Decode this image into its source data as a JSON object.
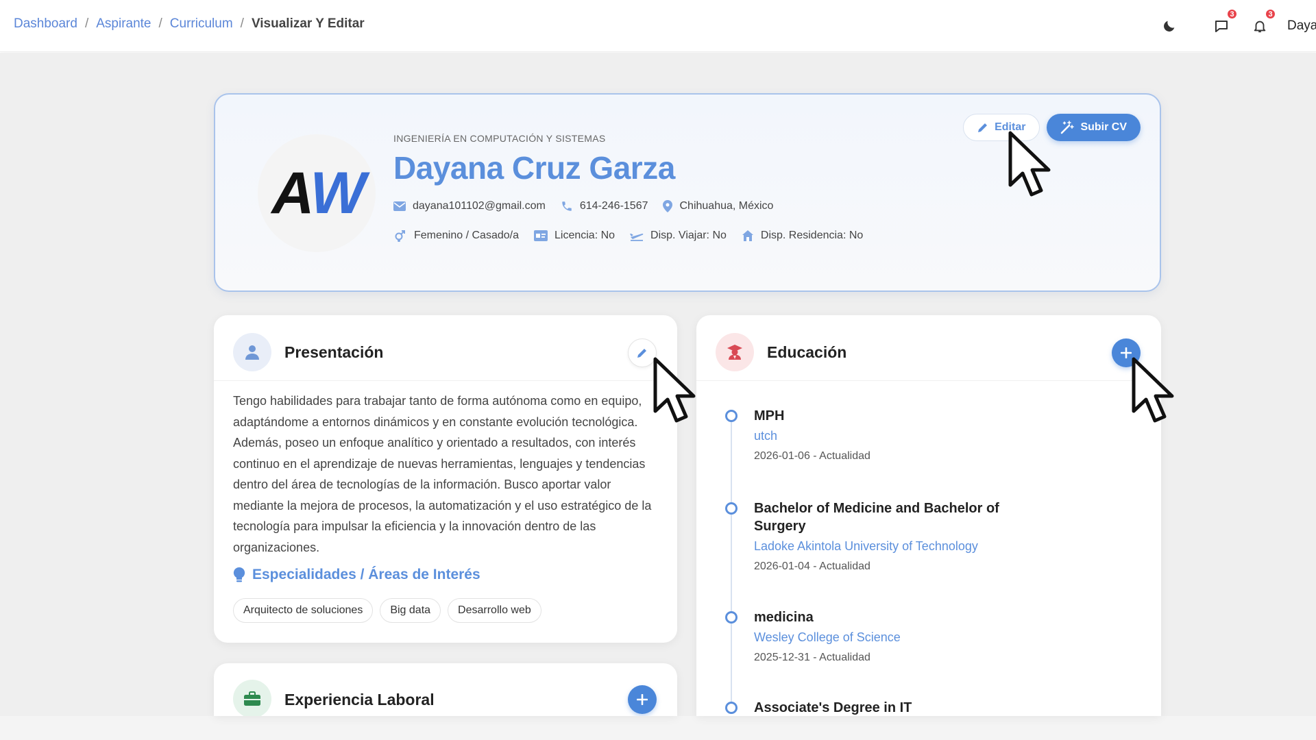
{
  "breadcrumb": {
    "items": [
      "Dashboard",
      "Aspirante",
      "Curriculum"
    ],
    "current": "Visualizar Y Editar",
    "separator": "/"
  },
  "topbar": {
    "theme_icon": "moon-icon",
    "messages_badge": "3",
    "notifications_badge": "3",
    "username": "Daya"
  },
  "profile": {
    "logo_text_a": "A",
    "logo_text_w": "W",
    "career": "INGENIERÍA EN COMPUTACIÓN Y SISTEMAS",
    "name": "Dayana Cruz Garza",
    "email": "dayana101102@gmail.com",
    "phone": "614-246-1567",
    "location": "Chihuahua, México",
    "gender_status": "Femenino / Casado/a",
    "license": "Licencia: No",
    "travel": "Disp. Viajar: No",
    "residence": "Disp. Residencia: No",
    "edit_label": "Editar",
    "upload_label": "Subir CV"
  },
  "presentation": {
    "title": "Presentación",
    "text": "Tengo habilidades para trabajar tanto de forma autónoma como en equipo, adaptándome a entornos dinámicos y en constante evolución tecnológica. Además, poseo un enfoque analítico y orientado a resultados, con interés continuo en el aprendizaje de nuevas herramientas, lenguajes y tendencias dentro del área de tecnologías de la información. Busco aportar valor mediante la mejora de procesos, la automatización y el uso estratégico de la tecnología para impulsar la eficiencia y la innovación dentro de las organizaciones.",
    "interests_title": "Especialidades / Áreas de Interés",
    "tags": [
      "Arquitecto de soluciones",
      "Big data",
      "Desarrollo web"
    ]
  },
  "experience": {
    "title": "Experiencia Laboral"
  },
  "education": {
    "title": "Educación",
    "items": [
      {
        "degree": "MPH",
        "school": "utch",
        "dates": "2026-01-06 - Actualidad"
      },
      {
        "degree": "Bachelor of Medicine and Bachelor of Surgery",
        "school": "Ladoke Akintola University of Technology",
        "dates": "2026-01-04 - Actualidad"
      },
      {
        "degree": "medicina",
        "school": "Wesley College of Science",
        "dates": "2025-12-31 - Actualidad"
      },
      {
        "degree": "Associate's Degree in IT",
        "school": "",
        "dates": ""
      }
    ]
  },
  "colors": {
    "accent": "#5b8fdc",
    "primary_button": "#4a86d9",
    "badge": "#e8424a",
    "logo_w": "#3a6fd6"
  }
}
